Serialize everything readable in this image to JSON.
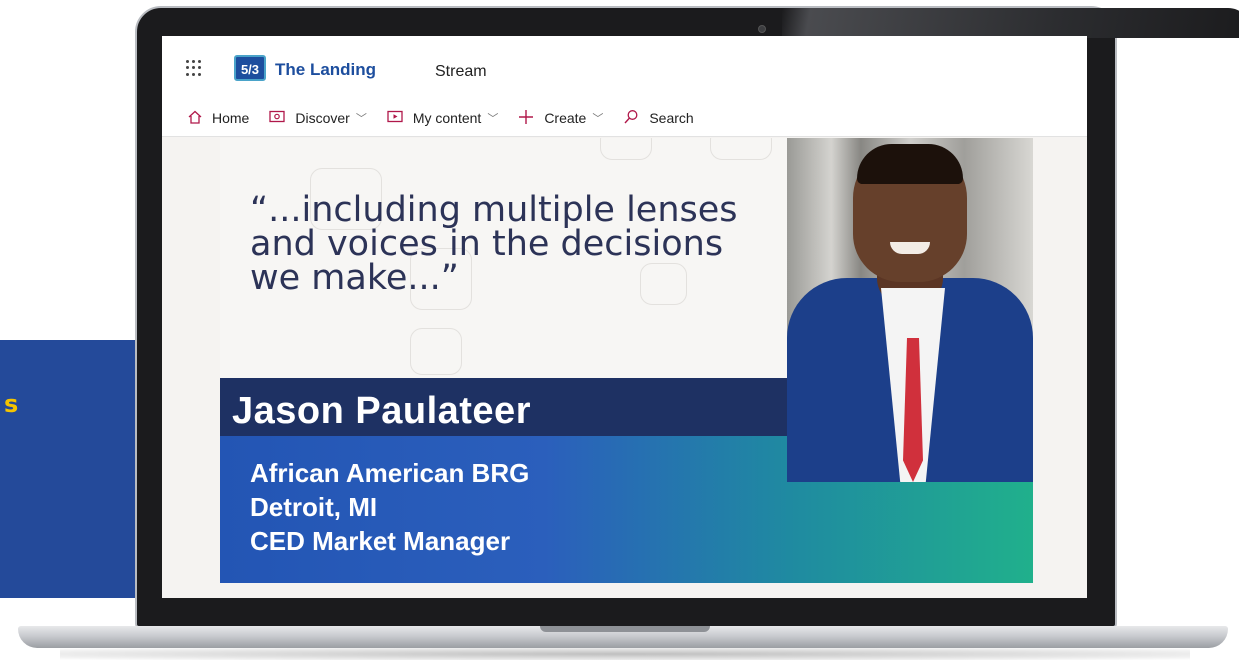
{
  "side_panel": {
    "text": "s"
  },
  "app": {
    "logo_text": "5/3",
    "site_title": "The Landing",
    "app_name": "Stream"
  },
  "nav": {
    "items": [
      {
        "label": "Home",
        "icon": "home-icon",
        "has_dropdown": false
      },
      {
        "label": "Discover",
        "icon": "discover-icon",
        "has_dropdown": true
      },
      {
        "label": "My content",
        "icon": "video-icon",
        "has_dropdown": true
      },
      {
        "label": "Create",
        "icon": "plus-icon",
        "has_dropdown": true
      },
      {
        "label": "Search",
        "icon": "search-icon",
        "has_dropdown": false
      }
    ]
  },
  "video": {
    "quote": "“...including multiple lenses and voices in the decisions we make...”",
    "name": "Jason Paulateer",
    "info": [
      "African American BRG",
      "Detroit, MI",
      "CED Market Manager"
    ]
  },
  "colors": {
    "brand_blue": "#1d4e9e",
    "accent_magenta": "#b0184a",
    "name_band": "#1e3163",
    "panel_blue": "#244a9a",
    "panel_text_yellow": "#f4c400"
  }
}
